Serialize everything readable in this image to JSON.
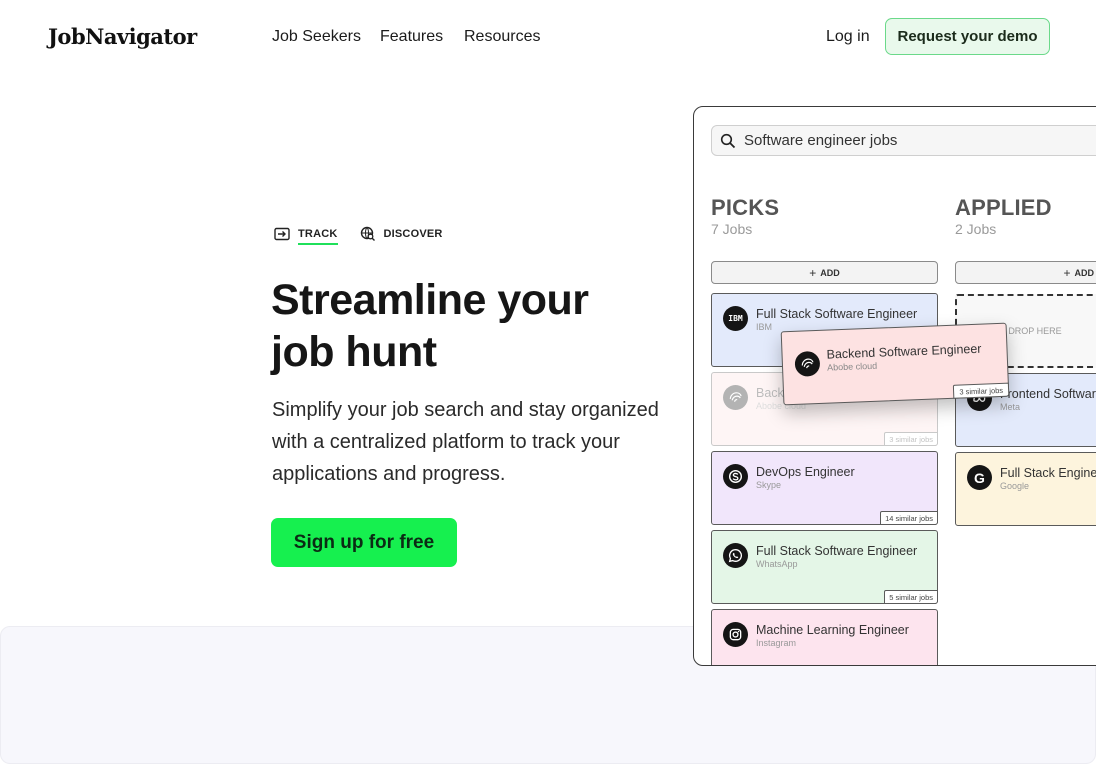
{
  "brand": {
    "logo": "JobNavigator"
  },
  "nav": {
    "links": [
      "Job Seekers",
      "Features",
      "Resources"
    ],
    "login": "Log in",
    "demo": "Request your demo"
  },
  "hero": {
    "tabs": [
      {
        "label": "TRACK",
        "icon": "tray-arrow-icon",
        "active": true
      },
      {
        "label": "DISCOVER",
        "icon": "globe-search-icon",
        "active": false
      }
    ],
    "title_line1": "Streamline your",
    "title_line2": "job hunt",
    "subtitle": "Simplify your job search and stay organized with a centralized platform to track your applications and progress.",
    "cta": "Sign up for free"
  },
  "app": {
    "search": {
      "icon": "search-icon",
      "value": "Software engineer jobs"
    },
    "add_label": "ADD",
    "columns": [
      {
        "title": "PICKS",
        "count": "7 Jobs",
        "cards": [
          {
            "title": "Full Stack Software Engineer",
            "company": "IBM",
            "logo": "IBM",
            "color": "#e3eafb",
            "similar": ""
          },
          {
            "title": "Backend Software Engineer",
            "company": "Abobe cloud",
            "logo": "adobe-cloud-icon",
            "color": "#fde2e2",
            "similar": "3 similar jobs"
          },
          {
            "title": "DevOps Engineer",
            "company": "Skype",
            "logo": "skype-icon",
            "color": "#f1e6fb",
            "similar": "14 similar jobs"
          },
          {
            "title": "Full Stack Software Engineer",
            "company": "WhatsApp",
            "logo": "whatsapp-icon",
            "color": "#e4f6e7",
            "similar": "5 similar jobs"
          },
          {
            "title": "Machine Learning Engineer",
            "company": "Instagram",
            "logo": "instagram-icon",
            "color": "#fde4ee",
            "similar": ""
          }
        ]
      },
      {
        "title": "APPLIED",
        "count": "2 Jobs",
        "dropzone": "DROP HERE",
        "cards": [
          {
            "title": "Frontend Software",
            "company": "Meta",
            "logo": "meta-icon",
            "color": "#e3eafb",
            "similar": ""
          },
          {
            "title": "Full Stack Enginee",
            "company": "Google",
            "logo": "G",
            "color": "#fdf4dd",
            "similar": ""
          }
        ]
      }
    ],
    "dragging": {
      "title": "Backend Software Engineer",
      "company": "Abobe cloud",
      "similar": "3 similar jobs"
    }
  }
}
